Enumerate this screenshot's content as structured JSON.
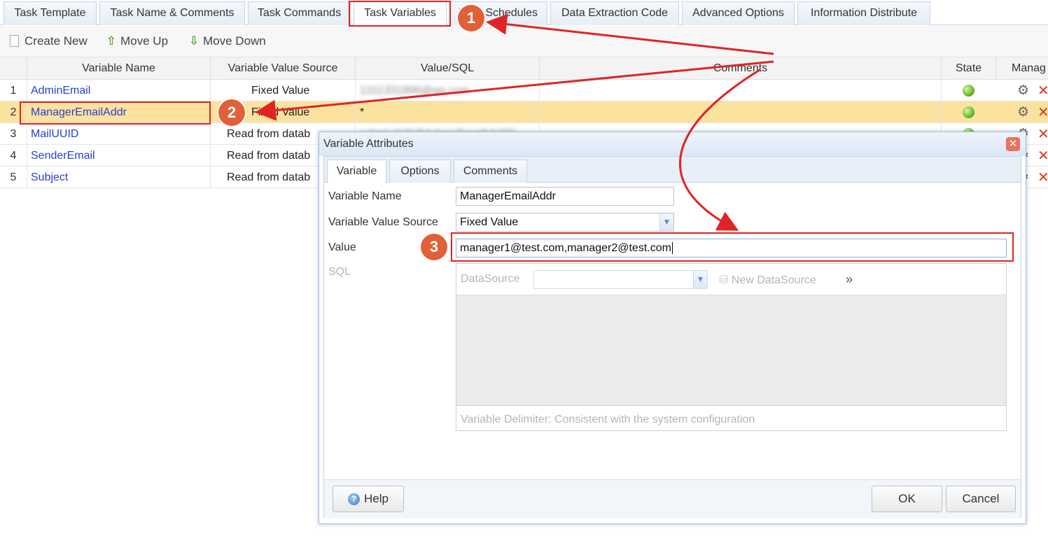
{
  "tabs": [
    "Task Template",
    "Task Name & Comments",
    "Task Commands",
    "Task Variables",
    "Task Schedules",
    "Data Extraction Code",
    "Advanced Options",
    "Information Distribute"
  ],
  "toolbar": {
    "create_new": "Create New",
    "move_up": "Move Up",
    "move_down": "Move Down"
  },
  "grid": {
    "headers": {
      "name": "Variable Name",
      "source": "Variable Value Source",
      "value": "Value/SQL",
      "comments": "Comments",
      "state": "State",
      "manage": "Manag"
    },
    "rows": [
      {
        "num": "1",
        "name": "AdminEmail",
        "source": "Fixed Value",
        "value": "1311331896@qq.com"
      },
      {
        "num": "2",
        "name": "ManagerEmailAddr",
        "source": "Fixed Value",
        "value": "*"
      },
      {
        "num": "3",
        "name": "MailUUID",
        "source": "Read from datab",
        "value": "select #{@@AdminEmailUUID}"
      },
      {
        "num": "4",
        "name": "SenderEmail",
        "source": "Read from datab",
        "value": ""
      },
      {
        "num": "5",
        "name": "Subject",
        "source": "Read from datab",
        "value": ""
      }
    ]
  },
  "dialog": {
    "title": "Variable Attributes",
    "tabs": [
      "Variable",
      "Options",
      "Comments"
    ],
    "labels": {
      "name": "Variable Name",
      "source": "Variable Value Source",
      "value": "Value",
      "sql": "SQL"
    },
    "name_value": "ManagerEmailAddr",
    "source_value": "Fixed Value",
    "value_value": "manager1@test.com,manager2@test.com",
    "datasource_label": "DataSource",
    "new_datasource": "New DataSource",
    "delimiter_note": "Variable Delimiter: Consistent with the system configuration",
    "help": "Help",
    "ok": "OK",
    "cancel": "Cancel"
  },
  "badges": [
    "1",
    "2",
    "3"
  ],
  "colors": {
    "annotation_red": "#e02424",
    "badge": "#e0603a",
    "selected_row": "#fbe29f",
    "link": "#2a3fcf"
  }
}
